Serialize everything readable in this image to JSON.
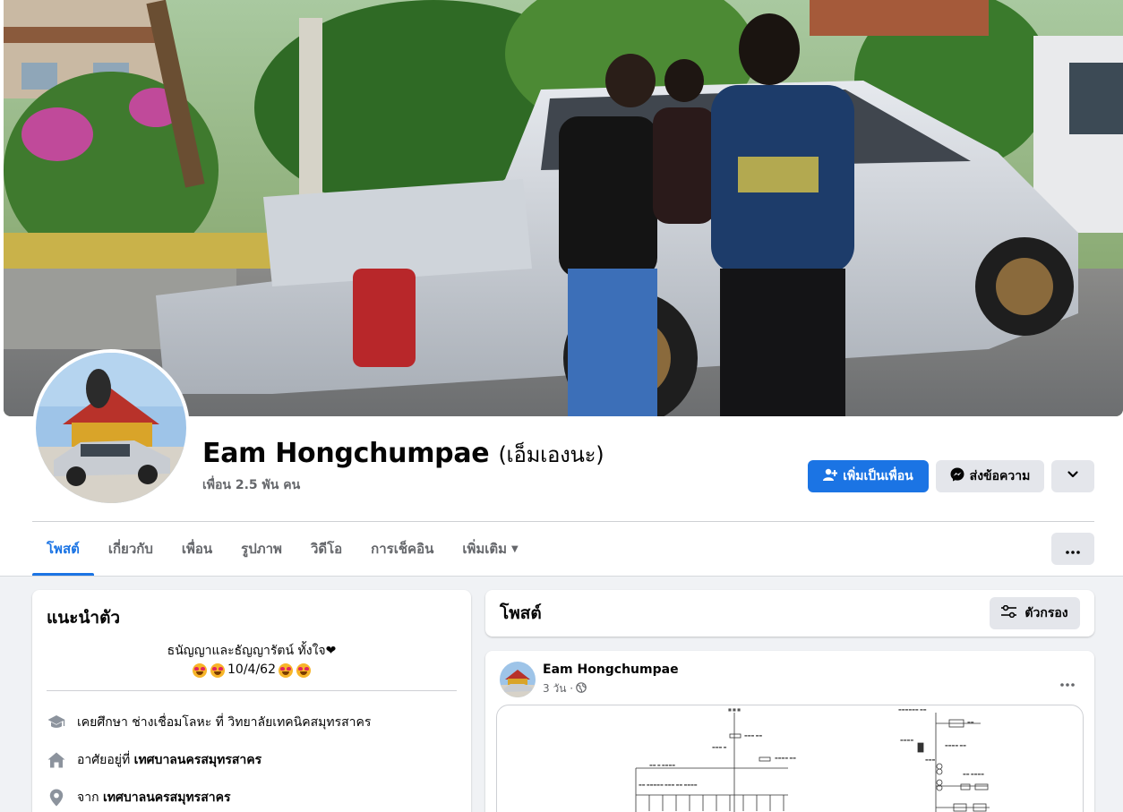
{
  "profile": {
    "name": "Eam Hongchumpae",
    "nickname": "(เอ็มเองนะ)",
    "friends": "เพื่อน 2.5 พัน คน"
  },
  "actions": {
    "add_friend": "เพิ่มเป็นเพื่อน",
    "message": "ส่งข้อความ"
  },
  "tabs": [
    {
      "label": "โพสต์",
      "active": true
    },
    {
      "label": "เกี่ยวกับ"
    },
    {
      "label": "เพื่อน"
    },
    {
      "label": "รูปภาพ"
    },
    {
      "label": "วิดีโอ"
    },
    {
      "label": "การเช็คอิน"
    },
    {
      "label": "เพิ่มเติม"
    }
  ],
  "intro": {
    "title": "แนะนำตัว",
    "bio_line1": "ธนัญญาและธัญญารัตน์ ทั้งใจ❤",
    "bio_date": "10/4/62",
    "education_prefix": "เคยศึกษา ช่างเชื่อมโลหะ ที่ ",
    "education_school": "วิทยาลัยเทคนิคสมุทรสาคร",
    "lives_prefix": "อาศัยอยู่ที่ ",
    "lives_place": "เทศบาลนครสมุทรสาคร",
    "from_prefix": "จาก ",
    "from_place": "เทศบาลนครสมุทรสาคร"
  },
  "posts": {
    "title": "โพสต์",
    "filter_label": "ตัวกรอง"
  },
  "post": {
    "author": "Eam Hongchumpae",
    "time": "3 วัน ·"
  },
  "icons": {
    "add_friend": "person-plus-icon",
    "message": "messenger-icon",
    "dropdown": "chevron-down-icon",
    "more": "more-dots-icon",
    "filter": "sliders-icon",
    "education": "graduation-cap-icon",
    "home": "home-icon",
    "location": "location-pin-icon",
    "audience": "globe-icon"
  },
  "colors": {
    "accent": "#1b74e4",
    "page_bg": "#f0f2f5",
    "secondary_btn": "#e4e6eb",
    "muted_text": "#65676b"
  }
}
